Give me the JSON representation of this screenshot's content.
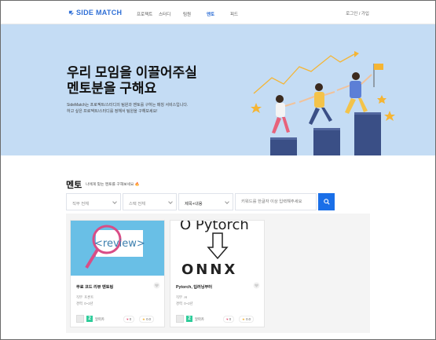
{
  "header": {
    "logo": "SIDE MATCH",
    "nav": [
      "프로젝트",
      "스터디",
      "팀원",
      "멘토",
      "피드"
    ],
    "active_nav": "멘토",
    "auth": "로그인 / 가입"
  },
  "hero": {
    "title": "우리 모임을 이끌어주실\n멘토분을 구해요",
    "description": "SideMatch는 프로젝트/스터디의 팀원과 멘토를 구하는 매칭 서비스입니다.\n하고 싶은 프로젝트/스터디를 정해서 팀원을 구해보세요!"
  },
  "mentor": {
    "title": "멘토",
    "subtitle": "나에게 맞는 멘토를 구해보세요",
    "subtitle_emoji": "🔥",
    "filters": {
      "role": "직무 전체",
      "stack": "스택 전체",
      "search_type": "제목+내용",
      "search_placeholder": "키워드를 한글자 이상 입력해주세요"
    },
    "cards": [
      {
        "title": "무료 코드 리뷰 멘토링",
        "role_label": "직무",
        "role_value": "프론트",
        "career_label": "경력",
        "career_value": "0~2년",
        "level": "2",
        "user": "알파카",
        "likes": "0",
        "rating": "0.0",
        "thumb_text": "<review>"
      },
      {
        "title": "Pytorch, 딥러닝부터",
        "role_label": "직무",
        "role_value": "AI",
        "career_label": "경력",
        "career_value": "0~2년",
        "level": "2",
        "user": "알파카",
        "likes": "0",
        "rating": "0.0",
        "thumb_top": "O Pytorch",
        "thumb_bottom": "ONNX"
      }
    ]
  },
  "colors": {
    "brand": "#2f6fd6",
    "hero_bg": "#c4dcf4",
    "search_btn": "#1a6fe8",
    "level_badge": "#2ecc9a",
    "illustration_navy": "#3a4f86",
    "star": "#f5b534"
  },
  "icons": [
    "logo-mark-icon",
    "chevron-down-icon",
    "search-icon",
    "heart-icon",
    "magnifier-icon",
    "arrow-down-icon",
    "star-icon",
    "flag-icon"
  ]
}
